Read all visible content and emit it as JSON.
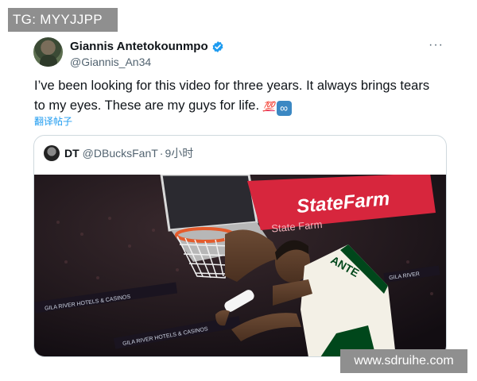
{
  "watermarks": {
    "top": "TG: MYYJJPP",
    "bottom": "www.sdruihe.com"
  },
  "tweet": {
    "author_name": "Giannis Antetokounmpo",
    "author_handle": "@Giannis_An34",
    "text": "I’ve been looking for this video for three years. It always brings tears to my eyes. These are my guys for life.",
    "emoji_100": "💯",
    "emoji_infinity": "∞",
    "translate_label": "翻译帖子",
    "more_icon": "more-horizontal-icon",
    "verified_color": "#1d9bf0"
  },
  "quoted": {
    "author_name": "DT",
    "author_handle": "@DBucksFanT",
    "separator": "·",
    "time": "9小时",
    "media": {
      "arena_banner": "StateFarm",
      "arena_banner_mirror": "State Farm",
      "ad_board": "GILA RIVER HOTELS & CASINOS",
      "ad_board_short": "GILA RIVER",
      "jersey_text": "ANTE"
    }
  },
  "colors": {
    "text_primary": "#0f1419",
    "text_secondary": "#536471",
    "link": "#1d9bf0",
    "border": "#cfd9de",
    "jersey_green": "#00471b",
    "banner_red": "#d7263d"
  }
}
